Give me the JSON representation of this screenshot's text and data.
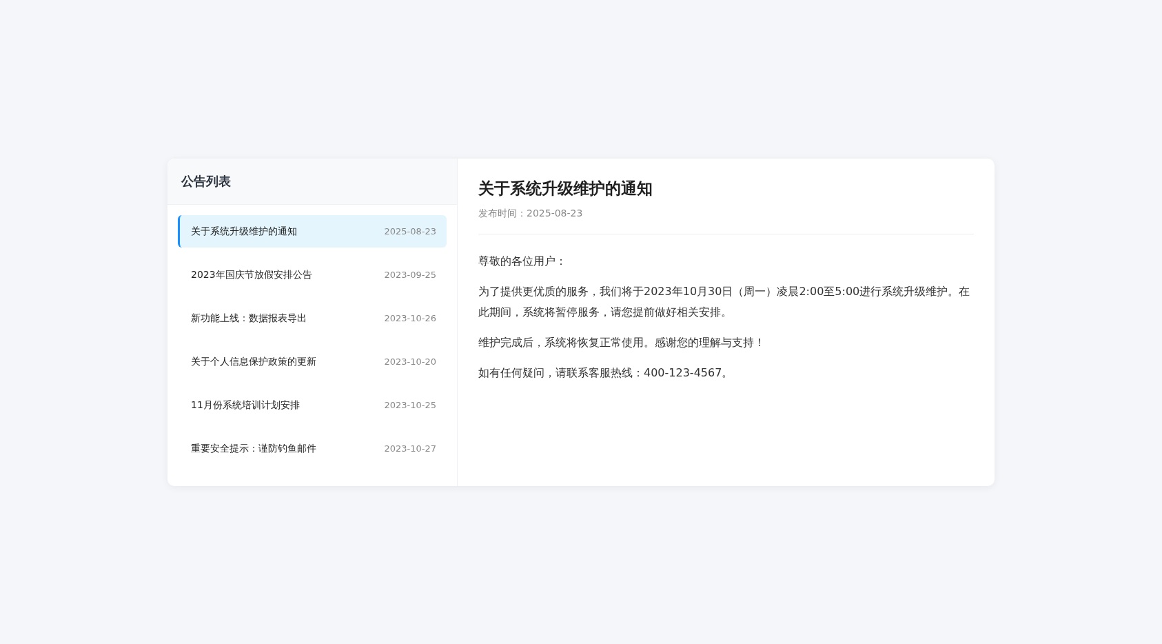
{
  "list_panel": {
    "title": "公告列表",
    "items": [
      {
        "title": "关于系统升级维护的通知",
        "date": "2025-08-23",
        "selected": true
      },
      {
        "title": "2023年国庆节放假安排公告",
        "date": "2023-09-25",
        "selected": false
      },
      {
        "title": "新功能上线：数据报表导出",
        "date": "2023-10-26",
        "selected": false
      },
      {
        "title": "关于个人信息保护政策的更新",
        "date": "2023-10-20",
        "selected": false
      },
      {
        "title": "11月份系统培训计划安排",
        "date": "2023-10-25",
        "selected": false
      },
      {
        "title": "重要安全提示：谨防钓鱼邮件",
        "date": "2023-10-27",
        "selected": false
      }
    ]
  },
  "detail": {
    "title": "关于系统升级维护的通知",
    "published": "发布时间：2025-08-23",
    "paragraphs": [
      "尊敬的各位用户：",
      "为了提供更优质的服务，我们将于2023年10月30日（周一）凌晨2:00至5:00进行系统升级维护。在此期间，系统将暂停服务，请您提前做好相关安排。",
      "维护完成后，系统将恢复正常使用。感谢您的理解与支持！",
      "如有任何疑问，请联系客服热线：400-123-4567。"
    ]
  }
}
